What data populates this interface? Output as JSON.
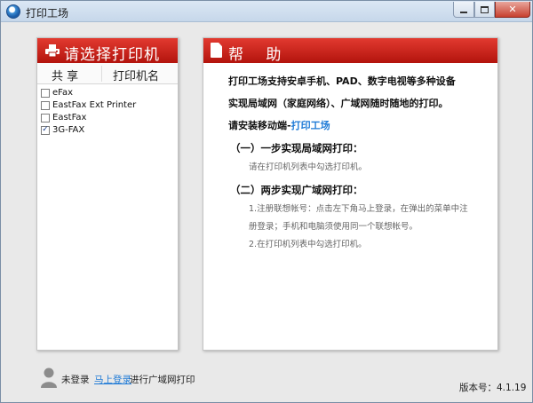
{
  "window": {
    "title": "打印工场",
    "controls": {
      "minimize": "",
      "maximize": "",
      "close": "✕"
    }
  },
  "left_panel": {
    "title": "请选择打印机",
    "columns": {
      "share": "共 享",
      "printer_name": "打印机名"
    },
    "printers": [
      {
        "name": "eFax",
        "checked": false
      },
      {
        "name": "EastFax Ext Printer",
        "checked": false
      },
      {
        "name": "EastFax",
        "checked": false
      },
      {
        "name": "3G-FAX",
        "checked": true
      }
    ]
  },
  "help_panel": {
    "title": "帮 助",
    "line1": "打印工场支持安卓手机、PAD、数字电视等多种设备",
    "line2": "实现局域网（家庭网络）、广域网随时随地的打印。",
    "install_prefix": "请安装移动端-",
    "install_link": "打印工场",
    "step1_title": "（一）一步实现局域网打印：",
    "step1_desc": "请在打印机列表中勾选打印机。",
    "step2_title": "（二）两步实现广域网打印：",
    "step2_desc1": "1.注册联想帐号：点击左下角马上登录，在弹出的菜单中注",
    "step2_desc2": "册登录；手机和电脑须使用同一个联想帐号。",
    "step2_desc3": "2.在打印机列表中勾选打印机。"
  },
  "footer": {
    "login_status": "未登录",
    "login_link": "马上登录",
    "login_hint": "进行广域网打印",
    "version": "版本号：4.1.19"
  },
  "colors": {
    "accent_red": "#c8201a",
    "link_blue": "#1e7ad6"
  },
  "icons": {
    "app": "app-icon",
    "printer": "printer-icon",
    "help": "document-icon",
    "user": "user-icon"
  }
}
